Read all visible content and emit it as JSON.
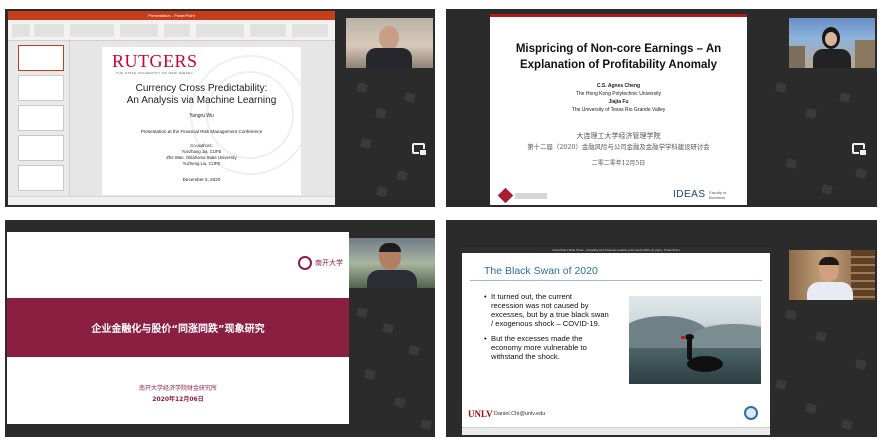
{
  "tile1": {
    "window_title": "Presentation - PowerPoint",
    "logo": "RUTGERS",
    "logo_sub": "THE STATE UNIVERSITY OF NEW JERSEY",
    "title_line1": "Currency Cross Predictability:",
    "title_line2": "An Analysis via Machine Learning",
    "author": "Yangru Wu",
    "venue": "Presentation at the Financial Risk Management Conference",
    "coauthors_label": "Co-authors:",
    "coauthor1": "Yuezhang Jia, CUFE",
    "coauthor2": "Zhe Wan, Oklahoma State University",
    "coauthor3": "Yuzheng Liu, CUFE",
    "date": "December 5, 2020"
  },
  "tile2": {
    "title_line1": "Mispricing of Non-core Earnings – An",
    "title_line2": "Explanation of Profitability Anomaly",
    "author1": "C.S. Agnes Cheng",
    "affil1": "The Hong Kong Polytechnic University",
    "author2": "Jiajia Fu",
    "affil2": "The University of Texas Rio Grande Valley",
    "cn_line1": "大连理工大学经济管理学院",
    "cn_line2": "第十二届（2020）金融风险与公司金融及金融学学科建设研讨会",
    "cn_date": "二零二零年12月5日",
    "logo_right": "IDEAS",
    "logo_right_sub": "Faculty of Business"
  },
  "tile3": {
    "logo_text": "南开大学",
    "title": "企业金融化与股价“同涨同跌”现象研究",
    "institute": "南开大学经济学院财金研究所",
    "date": "2020年12月06日"
  },
  "tile4": {
    "window_title": "PowerPoint Slide Show - [Volatility and financial markets post Covid 2020 (1).pptx] - PowerPoint",
    "heading": "The Black Swan of 2020",
    "bullet1": [
      "It turned out, the current",
      "recession was not caused by",
      "excesses, but by a true black swan",
      "/ exogenous shock – COVID-19."
    ],
    "bullet2": [
      "But the excesses made the",
      "economy more vulnerable to",
      "withstand the shock."
    ],
    "footer_logo": "UNLV",
    "footer_email": "Daniel.Chi@unlv.edu"
  },
  "colors": {
    "rutgers_red": "#cc0033",
    "nankai_maroon": "#8b1f41",
    "ppt_orange": "#c43e1c",
    "tile_bg": "#2b2b2b"
  }
}
